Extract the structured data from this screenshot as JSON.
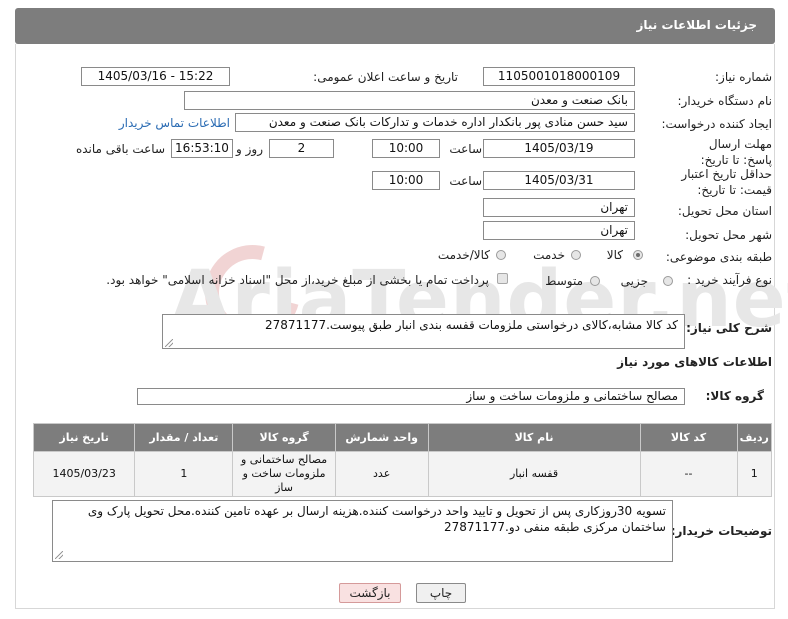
{
  "header": {
    "title": "جزئیات اطلاعات نیاز"
  },
  "fields": {
    "need_number": {
      "label": "شماره نیاز:",
      "value": "1105001018000109"
    },
    "announce_datetime": {
      "label": "تاریخ و ساعت اعلان عمومی:",
      "value": "1405/03/16 - 15:22"
    },
    "buyer_org": {
      "label": "نام دستگاه خریدار:",
      "value": "بانک صنعت و معدن"
    },
    "requester": {
      "label": "ایجاد کننده درخواست:",
      "value": "سید حسن منادی پور بانکدار اداره خدمات و تدارکات بانک صنعت و معدن",
      "contact_link": "اطلاعات تماس خریدار"
    },
    "reply_deadline": {
      "label": "مهلت ارسال پاسخ: تا تاریخ:",
      "date": "1405/03/19",
      "time_label": "ساعت",
      "time": "10:00",
      "days": "2",
      "days_label": "روز و",
      "remaining": "16:53:10",
      "remaining_label": "ساعت باقی مانده"
    },
    "price_validity": {
      "label": "حداقل تاریخ اعتبار قیمت: تا تاریخ:",
      "date": "1405/03/31",
      "time_label": "ساعت",
      "time": "10:00"
    },
    "delivery_province": {
      "label": "استان محل تحویل:",
      "value": "تهران"
    },
    "delivery_city": {
      "label": "شهر محل تحویل:",
      "value": "تهران"
    },
    "category": {
      "label": "طبقه بندی موضوعی:",
      "options": [
        "کالا",
        "خدمت",
        "کالا/خدمت"
      ],
      "selected": "کالا"
    },
    "purchase_process": {
      "label": "نوع فرآیند خرید :",
      "options": [
        "جزیی",
        "متوسط"
      ],
      "payment_note": "پرداخت تمام یا بخشی از مبلغ خرید،از محل \"اسناد خزانه اسلامی\" خواهد بود."
    }
  },
  "description": {
    "label": "شرح کلی نیاز:",
    "value": "کد کالا مشابه،کالای درخواستی ملزومات قفسه بندی انبار طبق پیوست.27871177"
  },
  "goods_section": {
    "title": "اطلاعات کالاهای مورد نیاز",
    "group_label": "گروه کالا:",
    "group_value": "مصالح ساختمانی و ملزومات ساخت و ساز"
  },
  "table": {
    "headers": [
      "ردیف",
      "کد کالا",
      "نام کالا",
      "واحد شمارش",
      "گروه کالا",
      "تعداد / مقدار",
      "تاریخ نیاز"
    ],
    "rows": [
      [
        "1",
        "--",
        "قفسه انبار",
        "عدد",
        "مصالح ساختمانی و ملزومات ساخت و ساز",
        "1",
        "1405/03/23"
      ]
    ]
  },
  "buyer_notes": {
    "label": "توضیحات خریدار:",
    "value": "تسویه 30روزکاری پس از تحویل و تایید واحد درخواست کننده.هزینه ارسال بر عهده تامین کننده.محل تحویل پارک وی ساختمان مرکزی طبقه منفی دو.27871177"
  },
  "buttons": {
    "print": "چاپ",
    "back": "بازگشت"
  },
  "watermark": "AriaTender.net"
}
